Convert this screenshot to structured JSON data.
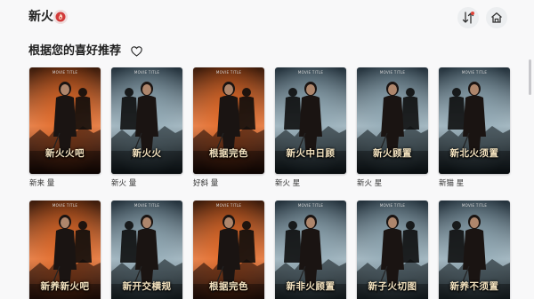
{
  "app": {
    "title": "新火"
  },
  "header": {
    "logo_icon": "flame-logo-icon",
    "sort_icon": "sort-icon",
    "home_icon": "home-icon"
  },
  "section": {
    "title": "根据您的喜好推荐",
    "icon": "heart-icon"
  },
  "rows": [
    [
      {
        "poster_title": "新火火吧",
        "caption": "新来 量",
        "theme": "fire"
      },
      {
        "poster_title": "新火火",
        "caption": "新火 量",
        "theme": "ice"
      },
      {
        "poster_title": "根据完色",
        "caption": "好斜 量",
        "theme": "fire"
      },
      {
        "poster_title": "新火中日顾",
        "caption": "新火 星",
        "theme": "ice"
      },
      {
        "poster_title": "新火顾置",
        "caption": "新火 星",
        "theme": "ice"
      },
      {
        "poster_title": "新北火须置",
        "caption": "新猫 星",
        "theme": "ice"
      }
    ],
    [
      {
        "poster_title": "新养新火吧",
        "caption": "",
        "theme": "fire"
      },
      {
        "poster_title": "新开交横规",
        "caption": "",
        "theme": "ice"
      },
      {
        "poster_title": "根据完色",
        "caption": "",
        "theme": "fire"
      },
      {
        "poster_title": "新非火顾置",
        "caption": "",
        "theme": "ice"
      },
      {
        "poster_title": "新子火切图",
        "caption": "",
        "theme": "ice"
      },
      {
        "poster_title": "新养不须置",
        "caption": "",
        "theme": "ice"
      }
    ]
  ],
  "poster_tag": "MOVIE TITLE",
  "colors": {
    "fire_top": "#3a1a0a",
    "fire_glow": "#e2621c",
    "ice_top": "#22303a",
    "ice_glow": "#8ea7b3"
  }
}
